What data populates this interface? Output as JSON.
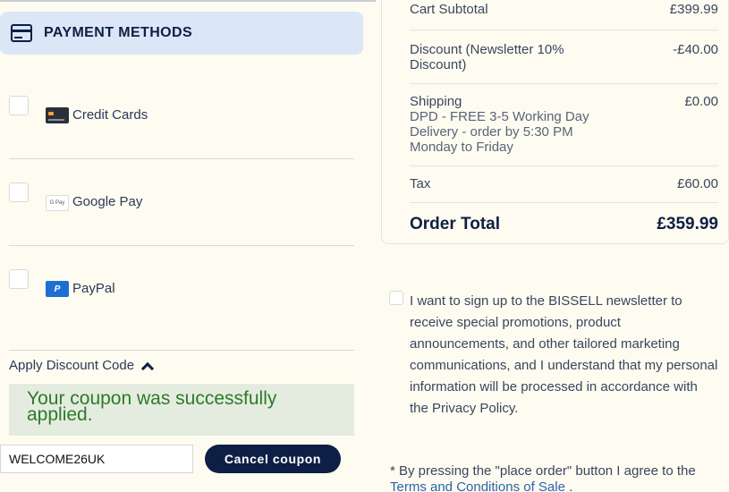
{
  "payment": {
    "header_title": "PAYMENT METHODS",
    "header_icon": "credit-card-icon",
    "methods": [
      {
        "label": "Credit Cards",
        "icon": "credit-card-logo-icon"
      },
      {
        "label": "Google Pay",
        "icon": "google-pay-logo-icon",
        "logo_text": "G Pay"
      },
      {
        "label": "PayPal",
        "icon": "paypal-logo-icon",
        "logo_text": "P"
      }
    ]
  },
  "discount": {
    "toggle_label": "Apply Discount Code",
    "success_message": "Your coupon was successfully applied.",
    "code_value": "WELCOME26UK",
    "cancel_label": "Cancel coupon"
  },
  "summary": {
    "cart_subtotal_label": "Cart Subtotal",
    "cart_subtotal_value": "£399.99",
    "discount_label": "Discount (Newsletter 10% Discount)",
    "discount_value": "-£40.00",
    "shipping_label": "Shipping",
    "shipping_value": "£0.00",
    "shipping_detail": "DPD - FREE 3-5 Working Day Delivery - order by 5:30 PM Monday to Friday",
    "tax_label": "Tax",
    "tax_value": "£60.00",
    "order_total_label": "Order Total",
    "order_total_value": "£359.99"
  },
  "newsletter": {
    "text": "I want to sign up to the BISSELL newsletter to receive special promotions, product announcements, and other tailored marketing communications, and I understand that my personal information will be processed in accordance with the Privacy Policy."
  },
  "terms": {
    "text": "* By pressing the \"place order\" button I agree to the",
    "link": "Terms and Conditions of Sale",
    "suffix": "."
  },
  "colors": {
    "brand_navy": "#0e1f45",
    "success_green": "#2d7a2a",
    "success_bg": "#e4ecdf",
    "header_bg": "#dbe6f6"
  }
}
